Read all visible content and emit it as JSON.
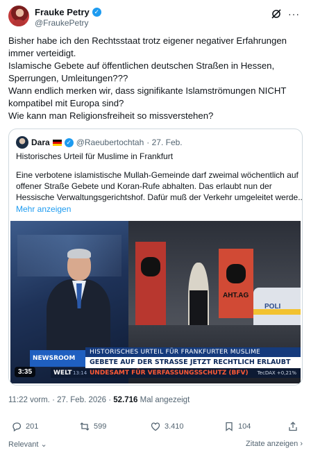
{
  "author": {
    "name": "Frauke Petry",
    "handle": "@FraukePetry"
  },
  "tweet": {
    "lines": [
      "Bisher habe ich den Rechtsstaat trotz eigener negativer Erfahrungen",
      "immer verteidigt.",
      "Islamische Gebete auf öffentlichen deutschen Straßen in Hessen,",
      "Sperrungen, Umleitungen???",
      "Wann endlich merken wir, dass signifikante Islamströmungen NICHT",
      "kompatibel mit Europa sind?",
      "Wie kann man Religionsfreiheit so missverstehen?"
    ]
  },
  "quote": {
    "name": "Dara",
    "handle": "@Raeubertochtah",
    "date": "· 27. Feb.",
    "title": "Historisches Urteil für Muslime in Frankfurt",
    "body": [
      "Eine verbotene islamistische Mullah-Gemeinde darf zweimal wöchentlich auf",
      "offener Straße Gebete und Koran-Rufe abhalten. Das erlaubt nun der",
      "Hessische Verwaltungsgerichtshof. Dafür muß der Verkehr umgeleitet werde..."
    ],
    "more": "Mehr anzeigen",
    "video": {
      "duration": "3:35",
      "logo": "NEWSROOM",
      "channel": "WELT",
      "clock": "13:14",
      "line1": "HISTORISCHES URTEIL FÜR FRANKFURTER MUSLIME",
      "line2": "GEBETE AUF DER STRASSE JETZT RECHTLICH ERLAUBT",
      "line3": "UNDESAMT FÜR VERFASSUNGSSCHUTZ (BFV)",
      "ticker": "TecDAX +0,21%",
      "banner_text": "AHT.AG",
      "police_text": "POLI"
    }
  },
  "meta": {
    "time": "11:22 vorm. · 27. Feb. 2026 · ",
    "views": "52.716",
    "views_label": " Mal angezeigt"
  },
  "actions": {
    "replies": "201",
    "reposts": "599",
    "likes": "3.410",
    "bookmarks": "104"
  },
  "footer": {
    "sort": "Relevant",
    "quotes": "Zitate anzeigen"
  },
  "icons": [
    "grok-icon",
    "more-icon",
    "verified-icon",
    "reply-icon",
    "repost-icon",
    "like-icon",
    "bookmark-icon",
    "share-icon",
    "chevron-down-icon",
    "chevron-right-icon"
  ],
  "colors": {
    "accent": "#1d9bf0",
    "text": "#0f1419",
    "muted": "#536471",
    "border": "#cfd9de"
  }
}
